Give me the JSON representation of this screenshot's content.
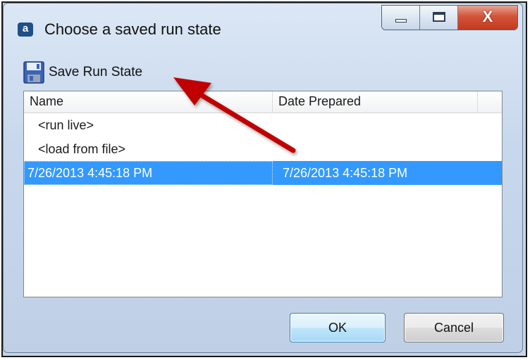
{
  "window": {
    "app_icon_glyph": "a",
    "title": "Choose a saved run state",
    "caption_buttons": [
      "minimize-icon",
      "maximize-icon",
      "close-icon"
    ],
    "close_glyph": "X"
  },
  "toolbar": {
    "save_icon": "floppy-disk-icon",
    "save_label": "Save Run State"
  },
  "list": {
    "columns": [
      "Name",
      "Date Prepared"
    ],
    "rows": [
      {
        "name": "<run live>",
        "date": "",
        "selected": false
      },
      {
        "name": "<load from file>",
        "date": "",
        "selected": false
      },
      {
        "name": "7/26/2013 4:45:18 PM",
        "date": "7/26/2013 4:45:18 PM",
        "selected": true
      }
    ]
  },
  "buttons": {
    "ok_label": "OK",
    "cancel_label": "Cancel"
  },
  "annotation": {
    "type": "arrow-icon",
    "color": "#c00000"
  },
  "colors": {
    "selection": "#3399ff",
    "close_button": "#c23b1e"
  }
}
